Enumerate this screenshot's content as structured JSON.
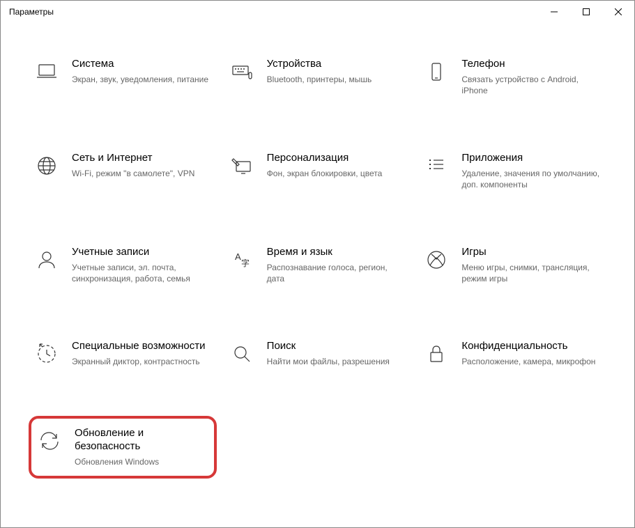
{
  "window": {
    "title": "Параметры"
  },
  "categories": [
    {
      "id": "system",
      "title": "Система",
      "desc": "Экран, звук, уведомления, питание",
      "icon": "laptop-icon"
    },
    {
      "id": "devices",
      "title": "Устройства",
      "desc": "Bluetooth, принтеры, мышь",
      "icon": "keyboard-icon"
    },
    {
      "id": "phone",
      "title": "Телефон",
      "desc": "Связать устройство с Android, iPhone",
      "icon": "phone-icon"
    },
    {
      "id": "network",
      "title": "Сеть и Интернет",
      "desc": "Wi-Fi, режим \"в самолете\", VPN",
      "icon": "globe-icon"
    },
    {
      "id": "personalization",
      "title": "Персонализация",
      "desc": "Фон, экран блокировки, цвета",
      "icon": "pen-monitor-icon"
    },
    {
      "id": "apps",
      "title": "Приложения",
      "desc": "Удаление, значения по умолчанию, доп. компоненты",
      "icon": "apps-icon"
    },
    {
      "id": "accounts",
      "title": "Учетные записи",
      "desc": "Учетные записи, эл. почта, синхронизация, работа, семья",
      "icon": "person-icon"
    },
    {
      "id": "time-language",
      "title": "Время и язык",
      "desc": "Распознавание голоса, регион, дата",
      "icon": "time-language-icon"
    },
    {
      "id": "gaming",
      "title": "Игры",
      "desc": "Меню игры, снимки, трансляция, режим игры",
      "icon": "xbox-icon"
    },
    {
      "id": "ease-of-access",
      "title": "Специальные возможности",
      "desc": "Экранный диктор, контрастность",
      "icon": "ease-of-access-icon"
    },
    {
      "id": "search",
      "title": "Поиск",
      "desc": "Найти мои файлы, разрешения",
      "icon": "search-icon"
    },
    {
      "id": "privacy",
      "title": "Конфиденциальность",
      "desc": "Расположение, камера, микрофон",
      "icon": "lock-icon"
    },
    {
      "id": "update-security",
      "title": "Обновление и безопасность",
      "desc": "Обновления Windows",
      "icon": "sync-icon",
      "highlighted": true
    }
  ]
}
